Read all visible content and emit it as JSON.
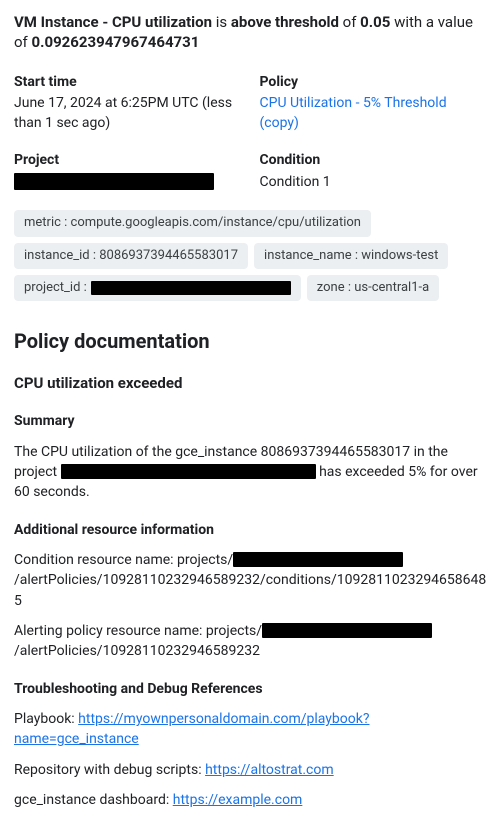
{
  "headline": {
    "part1_b": "VM Instance - CPU utilization",
    "part2_n": " is ",
    "part3_b": "above threshold",
    "part4_n": " of ",
    "part5_b": "0.05",
    "part6_n": " with a value of ",
    "part7_b": "0.092623947967464731"
  },
  "info": {
    "start_time_label": "Start time",
    "start_time_value": "June 17, 2024 at 6:25PM UTC (less than 1 sec ago)",
    "policy_label": "Policy",
    "policy_link": "CPU Utilization - 5% Threshold (copy)",
    "project_label": "Project",
    "condition_label": "Condition",
    "condition_value": "Condition 1"
  },
  "tags": {
    "metric": "metric : compute.googleapis.com/instance/cpu/utilization",
    "instance_id": "instance_id : 8086937394465583017",
    "instance_name": "instance_name : windows-test",
    "project_id_k": "project_id :",
    "zone": "zone : us-central1-a"
  },
  "doc": {
    "heading": "Policy documentation",
    "sub1": "CPU utilization exceeded",
    "summary_h": "Summary",
    "summary_pre": "The CPU utilization of the gce_instance 8086937394465583017 in the project ",
    "summary_post": " has exceeded 5% for over 60 seconds.",
    "addl_h": "Additional resource information",
    "cond_pre": "Condition resource name: projects/",
    "cond_post": "/alertPolicies/10928110232946589232/conditions/10928110232946586485",
    "pol_pre": "Alerting policy resource name: projects/",
    "pol_post": "/alertPolicies/10928110232946589232",
    "trouble_h": "Troubleshooting and Debug References",
    "playbook_k": "Playbook: ",
    "playbook_v": "https://myownpersonaldomain.com/playbook?name=gce_instance",
    "repo_k": "Repository with debug scripts: ",
    "repo_v": "https://altostrat.com",
    "dash_k": "gce_instance dashboard: ",
    "dash_v": "https://example.com"
  }
}
